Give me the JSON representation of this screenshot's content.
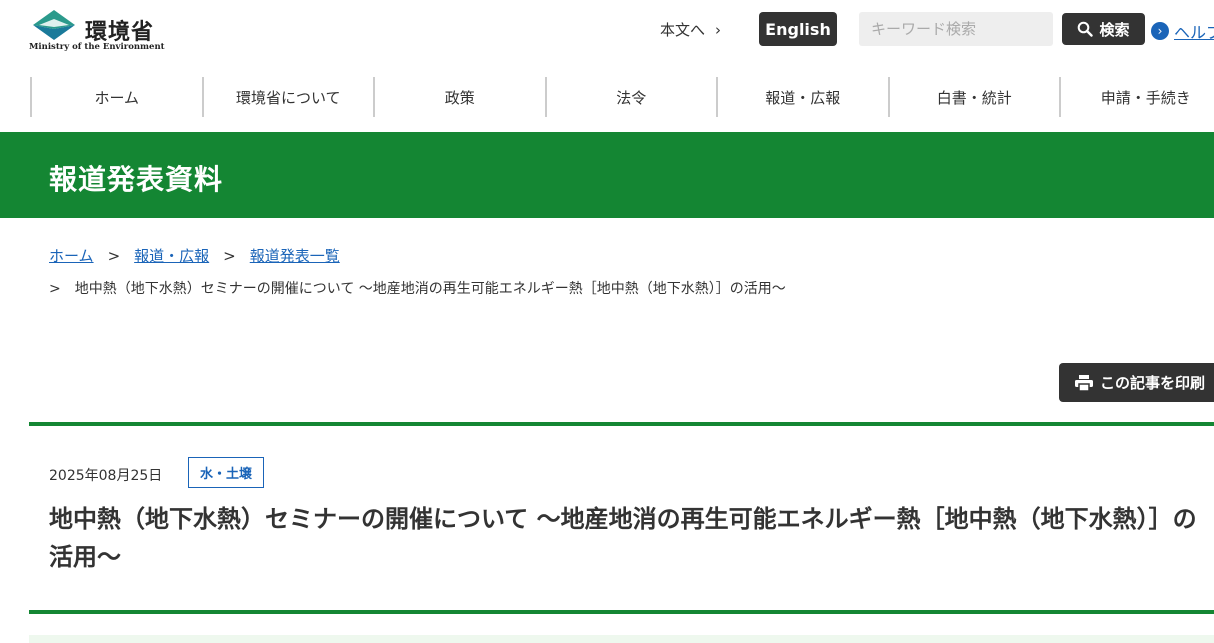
{
  "header": {
    "logo_text": "環境省",
    "logo_subtext": "Ministry of the Environment",
    "skip_link": "本文へ",
    "english_label": "English",
    "search_placeholder": "キーワード検索",
    "search_button": "検索",
    "help_label": "ヘルプ",
    "brand_color": "#148633",
    "link_color": "#1a64b8"
  },
  "nav": {
    "items": [
      "ホーム",
      "環境省について",
      "政策",
      "法令",
      "報道・広報",
      "白書・統計",
      "申請・手続き"
    ]
  },
  "banner": {
    "title": "報道発表資料"
  },
  "breadcrumb": {
    "items": [
      "ホーム",
      "報道・広報",
      "報道発表一覧"
    ],
    "separator": ">",
    "current": "地中熱（地下水熱）セミナーの開催について 〜地産地消の再生可能エネルギー熱［地中熱（地下水熱）］の活用〜"
  },
  "print_button": "この記事を印刷",
  "article": {
    "date": "2025年08月25日",
    "category": "水・土壌",
    "title": "地中熱（地下水熱）セミナーの開催について 〜地産地消の再生可能エネルギー熱［地中熱（地下水熱）］の活用〜"
  }
}
